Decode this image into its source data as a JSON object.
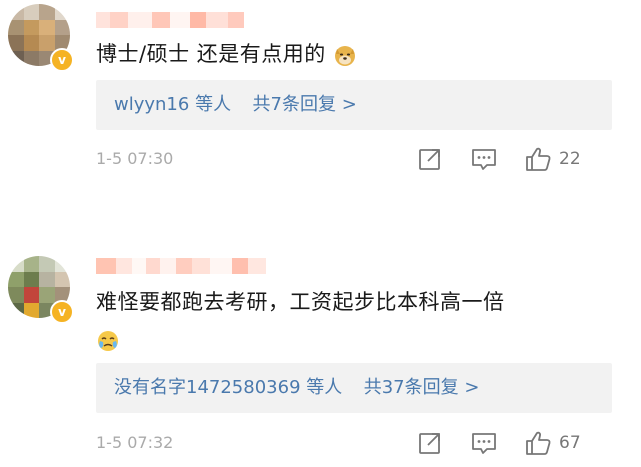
{
  "comments": [
    {
      "text": "博士/硕士 还是有点用的",
      "emoji": "doge-emoji",
      "reply_summary": {
        "users": "wlyyn16",
        "suffix": "等人",
        "count_text": "共7条回复 >"
      },
      "timestamp": "1-5 07:30",
      "likes": "22"
    },
    {
      "text_line1": "难怪要都跑去考研，工资起步比本科高一倍",
      "emoji": "crying-emoji",
      "reply_summary": {
        "users": "没有名字1472580369",
        "suffix": "等人",
        "count_text": "共37条回复 >"
      },
      "timestamp": "1-5 07:32",
      "likes": "67"
    }
  ],
  "icons": {
    "share": "share-icon",
    "comment": "comment-icon",
    "like": "like-icon",
    "verified": "verified-badge-icon"
  },
  "colors": {
    "link": "#4a79ad",
    "badge": "#f5b324",
    "reply_bg": "#f2f2f2",
    "muted": "#aaaaaa"
  }
}
